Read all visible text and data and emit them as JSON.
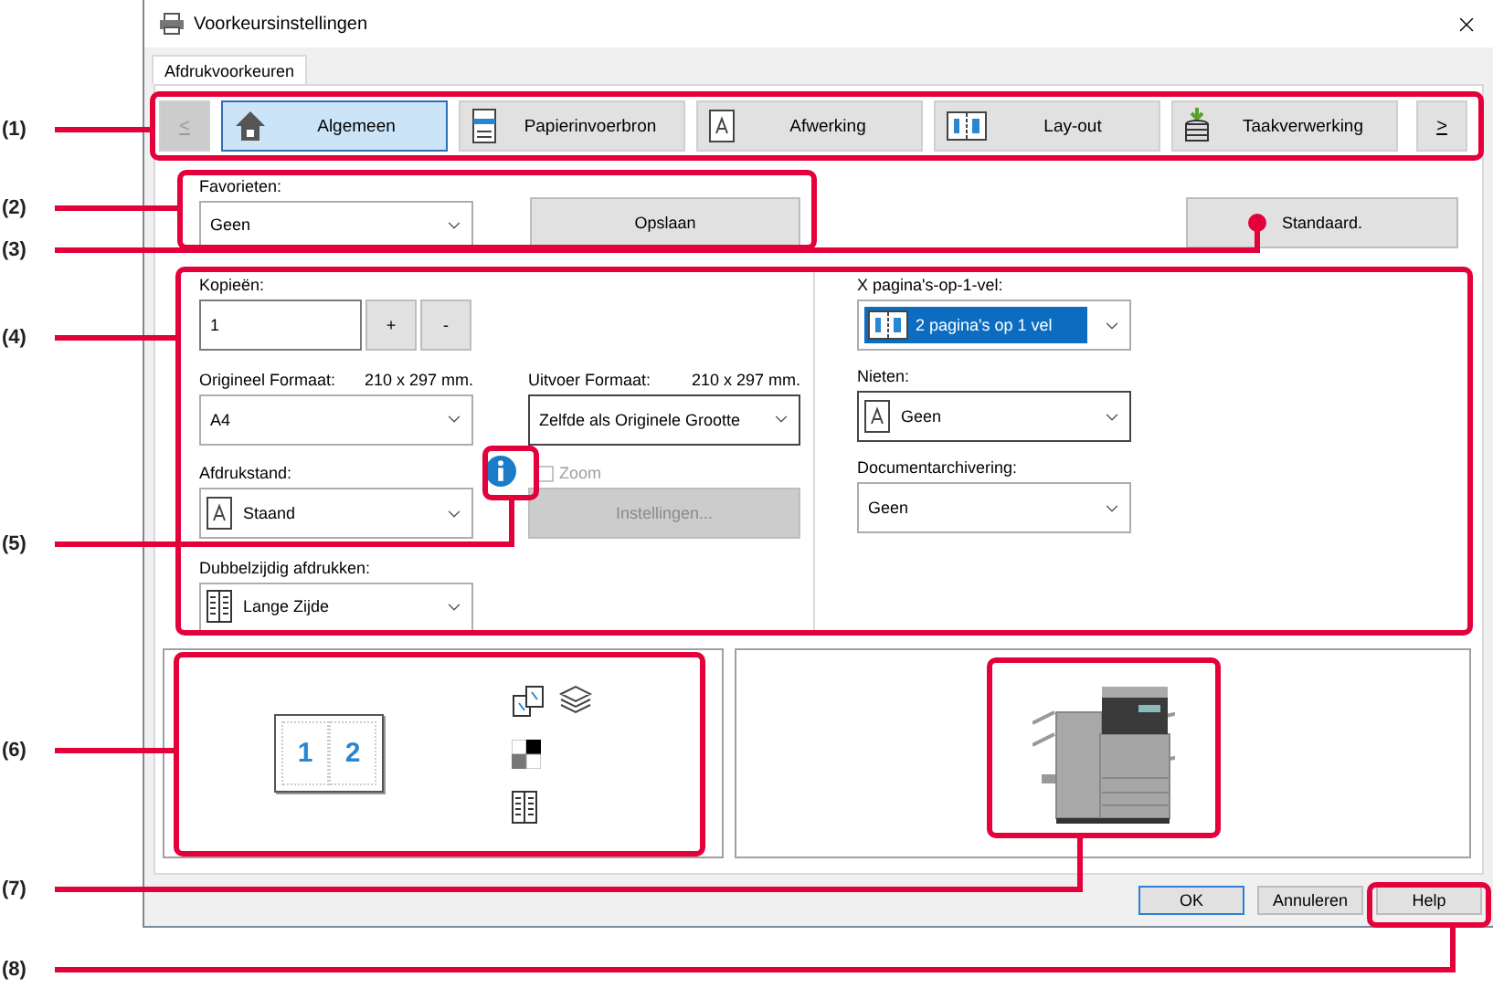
{
  "window": {
    "title": "Voorkeursinstellingen"
  },
  "tabs": [
    {
      "label": "Afdrukvoorkeuren",
      "selected": true
    }
  ],
  "nav": {
    "prev": {
      "label": "<",
      "disabled": true
    },
    "next": {
      "label": ">",
      "disabled": false
    },
    "items": [
      {
        "label": "Algemeen",
        "kind": "home",
        "selected": true
      },
      {
        "label": "Papierinvoerbron",
        "kind": "tray",
        "selected": false
      },
      {
        "label": "Afwerking",
        "kind": "page",
        "selected": false
      },
      {
        "label": "Lay-out",
        "kind": "layout",
        "selected": false
      },
      {
        "label": "Taakverwerking",
        "kind": "storage",
        "selected": false
      }
    ]
  },
  "favorites": {
    "label": "Favorieten:",
    "value": "Geen"
  },
  "save_button": "Opslaan",
  "default_button": "Standaard.",
  "copies": {
    "label": "Kopieën:",
    "value": "1",
    "plus": "+",
    "minus": "-"
  },
  "original_size": {
    "label": "Origineel Formaat:",
    "size": "210 x 297 mm.",
    "value": "A4"
  },
  "output_size": {
    "label": "Uitvoer Formaat:",
    "size": "210 x 297 mm.",
    "value": "Zelfde als Originele Grootte"
  },
  "orientation": {
    "label": "Afdrukstand:",
    "value": "Staand"
  },
  "zoom": {
    "label": "Zoom",
    "checked": false,
    "disabled": true
  },
  "settings_button": {
    "label": "Instellingen...",
    "disabled": true
  },
  "duplex": {
    "label": "Dubbelzijdig afdrukken:",
    "value": "Lange Zijde"
  },
  "n_up": {
    "label": "X pagina's-op-1-vel:",
    "value": "2 pagina's op 1 vel",
    "focused": true
  },
  "staple": {
    "label": "Nieten:",
    "value": "Geen"
  },
  "archive": {
    "label": "Documentarchivering:",
    "value": "Geen"
  },
  "preview": {
    "page_numbers": [
      "1",
      "2"
    ]
  },
  "buttons": [
    {
      "label": "OK",
      "default": true
    },
    {
      "label": "Annuleren",
      "default": false
    },
    {
      "label": "Help",
      "default": false
    }
  ],
  "callouts": [
    "(1)",
    "(2)",
    "(3)",
    "(4)",
    "(5)",
    "(6)",
    "(7)",
    "(8)"
  ]
}
